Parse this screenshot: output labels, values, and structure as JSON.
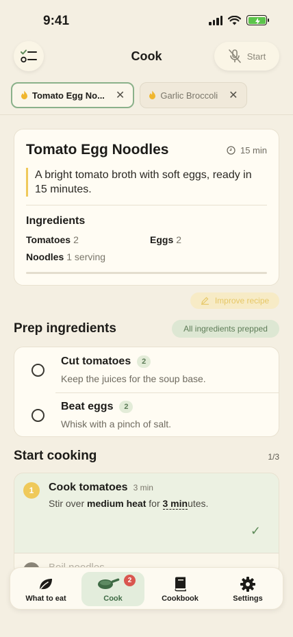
{
  "status": {
    "time": "9:41"
  },
  "header": {
    "title": "Cook",
    "start_label": "Start"
  },
  "tabs": [
    {
      "label": "Tomato Egg No...",
      "active": true
    },
    {
      "label": "Garlic Broccoli",
      "active": false
    }
  ],
  "recipe": {
    "title": "Tomato Egg Noodles",
    "time": "15 min",
    "description": "A bright tomato broth with soft eggs, ready in 15 minutes.",
    "ingredients_heading": "Ingredients",
    "ingredients": [
      {
        "name": "Tomatoes",
        "qty": "2"
      },
      {
        "name": "Eggs",
        "qty": "2"
      },
      {
        "name": "Noodles",
        "qty": "1 serving"
      }
    ]
  },
  "improve_label": "Improve recipe",
  "prep": {
    "title": "Prep ingredients",
    "badge": "All ingredients prepped",
    "items": [
      {
        "name": "Cut tomatoes",
        "count": "2",
        "note": "Keep the juices for the soup base."
      },
      {
        "name": "Beat eggs",
        "count": "2",
        "note": "Whisk with a pinch of salt."
      }
    ]
  },
  "cooking": {
    "title": "Start cooking",
    "progress": "1/3",
    "step": {
      "number": "1",
      "name": "Cook tomatoes",
      "duration": "3 min",
      "text_pre": "Stir over ",
      "text_bold": "medium heat",
      "text_mid": " for ",
      "text_timer": "3 min",
      "text_post": "utes."
    },
    "next_step_name": "Boil noodles"
  },
  "nav": {
    "items": [
      {
        "label": "What to eat"
      },
      {
        "label": "Cook",
        "badge": "2"
      },
      {
        "label": "Cookbook"
      },
      {
        "label": "Settings"
      }
    ]
  },
  "colors": {
    "accent_green": "#5d7c57",
    "accent_yellow": "#efc95a",
    "badge_red": "#d9564f"
  }
}
